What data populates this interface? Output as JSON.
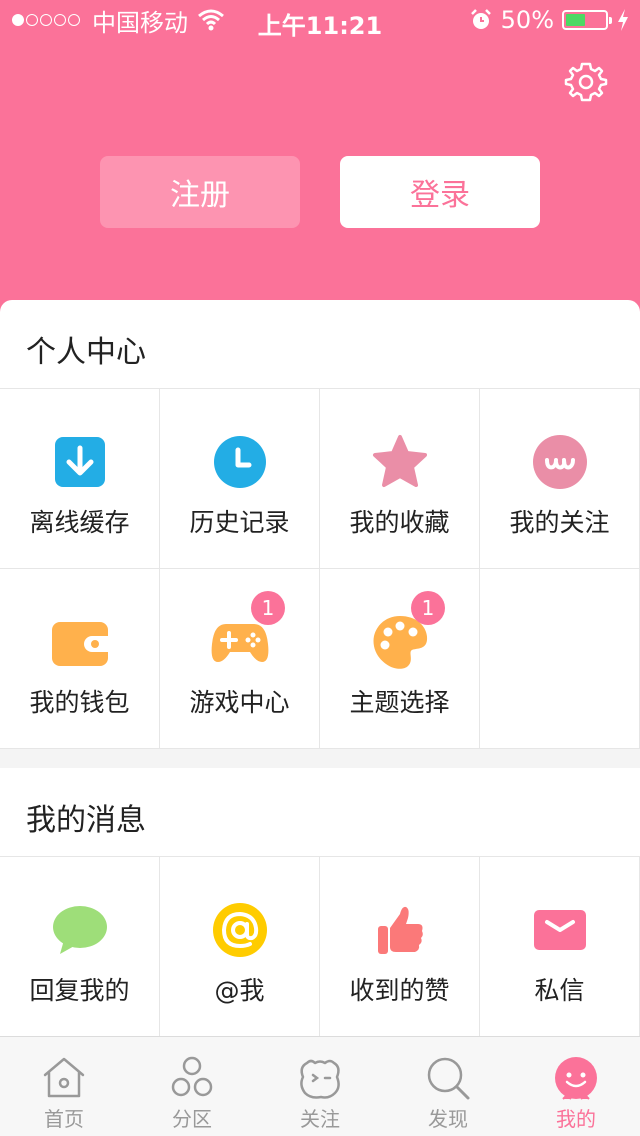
{
  "status_bar": {
    "carrier": "中国移动",
    "time": "上午11:21",
    "battery": "50%",
    "battery_level": 0.5
  },
  "auth": {
    "register_label": "注册",
    "login_label": "登录"
  },
  "personal_center": {
    "title": "个人中心",
    "items": [
      {
        "label": "离线缓存",
        "icon": "download-icon"
      },
      {
        "label": "历史记录",
        "icon": "clock-icon"
      },
      {
        "label": "我的收藏",
        "icon": "star-icon"
      },
      {
        "label": "我的关注",
        "icon": "follow-face-icon"
      },
      {
        "label": "我的钱包",
        "icon": "wallet-icon"
      },
      {
        "label": "游戏中心",
        "icon": "gamepad-icon",
        "badge": "1"
      },
      {
        "label": "主题选择",
        "icon": "palette-icon",
        "badge": "1"
      }
    ]
  },
  "messages": {
    "title": "我的消息",
    "items": [
      {
        "label": "回复我的",
        "icon": "speech-bubble-icon"
      },
      {
        "label": "@我",
        "icon": "at-icon"
      },
      {
        "label": "收到的赞",
        "icon": "thumbs-up-icon"
      },
      {
        "label": "私信",
        "icon": "envelope-icon"
      }
    ]
  },
  "tabbar": {
    "tabs": [
      {
        "label": "首页",
        "icon": "home-icon"
      },
      {
        "label": "分区",
        "icon": "categories-icon"
      },
      {
        "label": "关注",
        "icon": "follow-icon"
      },
      {
        "label": "发现",
        "icon": "search-icon"
      },
      {
        "label": "我的",
        "icon": "profile-icon",
        "active": true
      }
    ]
  },
  "colors": {
    "accent": "#fb7299",
    "download": "#23ade5",
    "star": "#ea8ea7",
    "wallet": "#ffb14c",
    "chat": "#9ede79",
    "at": "#ffcc00",
    "thumb": "#fb7979"
  }
}
